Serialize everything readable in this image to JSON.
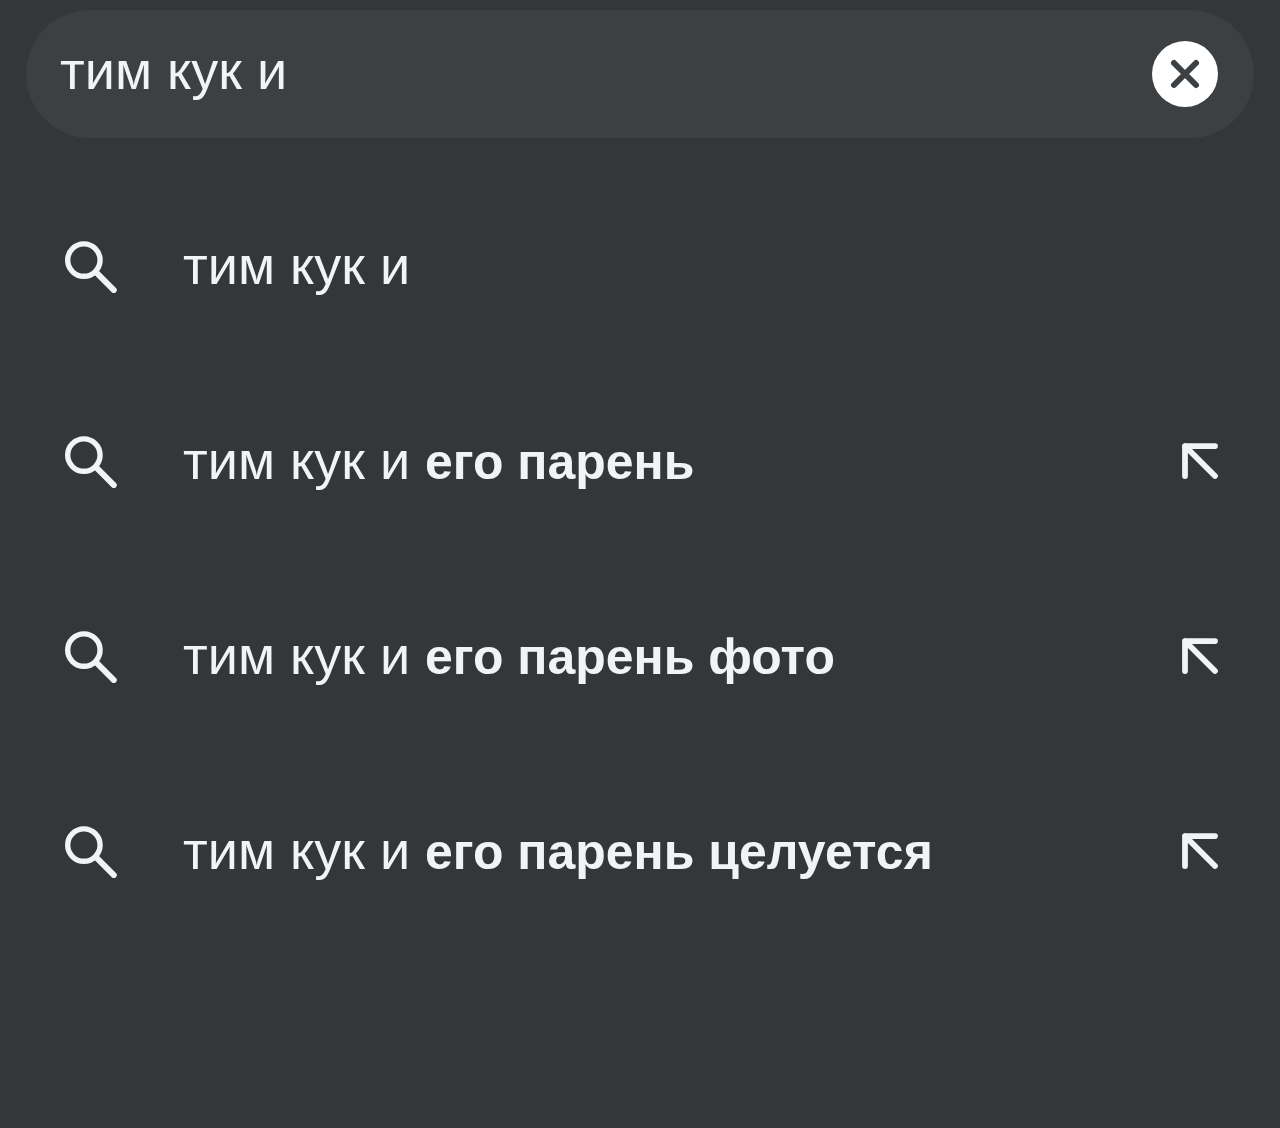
{
  "search": {
    "value": "тим кук и"
  },
  "suggestions": [
    {
      "kind": "typed",
      "text": "тим кук и"
    },
    {
      "kind": "completion",
      "text": "тим кук и **его парень**"
    },
    {
      "kind": "completion",
      "text": "тим кук и **его парень фото**"
    },
    {
      "kind": "completion",
      "text": "тим кук и **его парень целуется**"
    }
  ]
}
